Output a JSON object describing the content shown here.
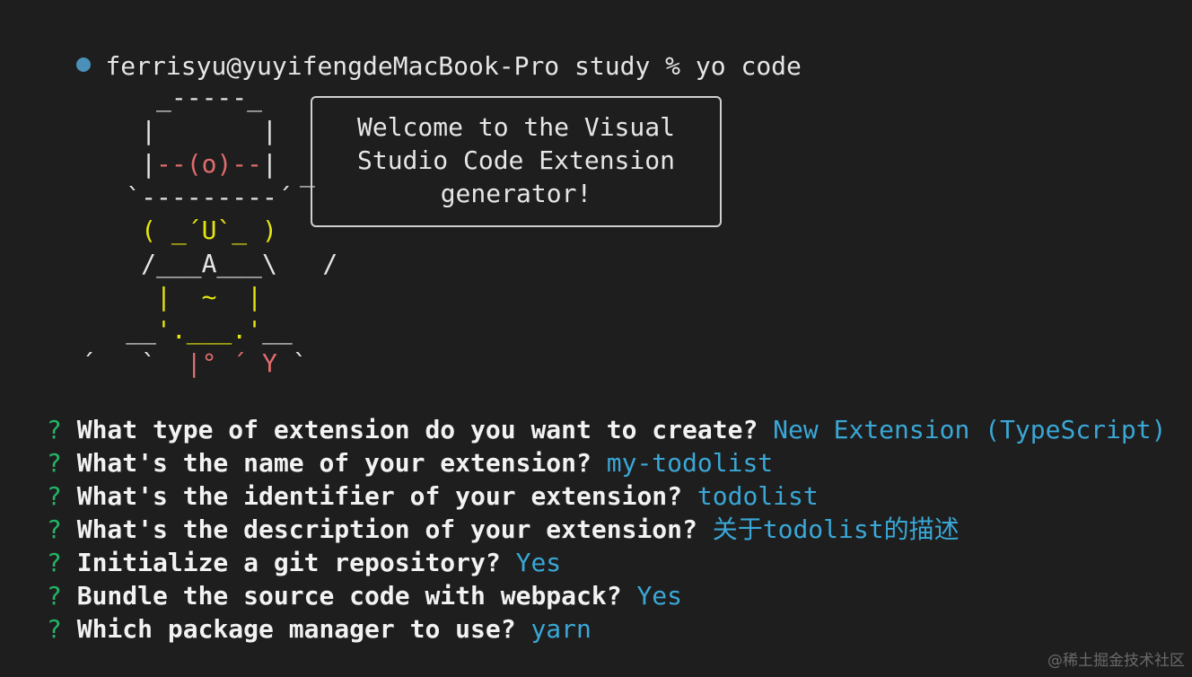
{
  "terminal": {
    "prompt": "ferrisyu@yuyifengdeMacBook-Pro study % ",
    "command": "yo code"
  },
  "mascot": {
    "line1": "       _-----_",
    "line2_a": "      |",
    "line2_b": "       |",
    "line3_a": "      |",
    "line3_face": "--(o)--",
    "line3_b": "|",
    "line4": "     `---------´",
    "line5_face": "( _´U`_ )",
    "line6": "      /___A___\\   /",
    "line7": "|  ~  |",
    "line8_a": "     __",
    "line8_b": "'.___.'",
    "line8_c": "__",
    "line9_a": "  ´   `  ",
    "line9_b": "|° ´ Y",
    "line9_c": " `"
  },
  "speech": {
    "text": "Welcome to the Visual\nStudio Code Extension\ngenerator!",
    "tail": "_"
  },
  "questions": [
    {
      "mark": "?",
      "text": "What type of extension do you want to create?",
      "answer": "New Extension (TypeScript)"
    },
    {
      "mark": "?",
      "text": "What's the name of your extension?",
      "answer": "my-todolist"
    },
    {
      "mark": "?",
      "text": "What's the identifier of your extension?",
      "answer": "todolist"
    },
    {
      "mark": "?",
      "text": "What's the description of your extension?",
      "answer": "关于todolist的描述"
    },
    {
      "mark": "?",
      "text": "Initialize a git repository?",
      "answer": "Yes"
    },
    {
      "mark": "?",
      "text": "Bundle the source code with webpack?",
      "answer": "Yes"
    },
    {
      "mark": "?",
      "text": "Which package manager to use?",
      "answer": "yarn"
    }
  ],
  "watermark": "@稀土掘金技术社区",
  "colors": {
    "background": "#1e1e1e",
    "prompt_dot": "#4a90b8",
    "question_mark": "#23b566",
    "answer": "#3aa7d6",
    "mascot_red": "#e06c6c",
    "mascot_yellow": "#e5e510"
  }
}
